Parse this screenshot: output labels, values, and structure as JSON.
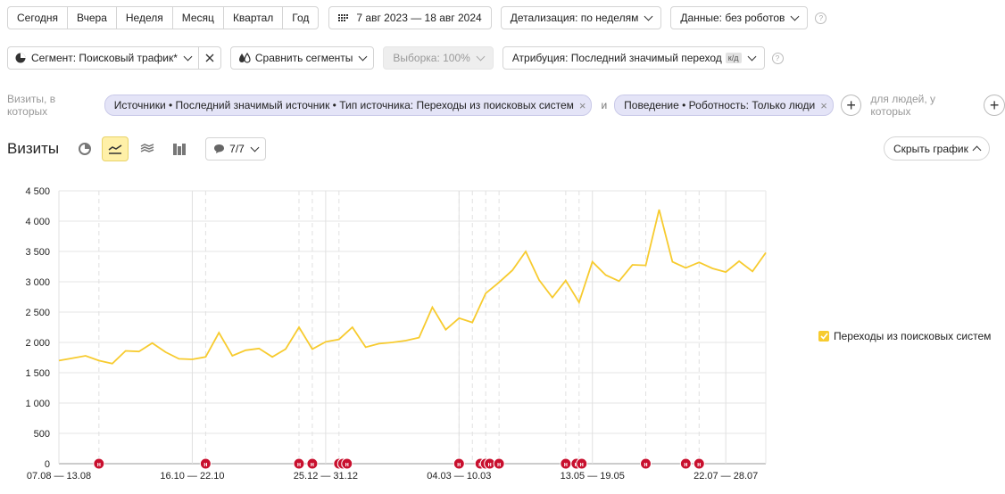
{
  "toolbar": {
    "periods": [
      "Сегодня",
      "Вчера",
      "Неделя",
      "Месяц",
      "Квартал",
      "Год"
    ],
    "date_range": "7 авг 2023 — 18 авг 2024",
    "detail": "Детализация: по неделям",
    "data": "Данные: без роботов"
  },
  "segment_row": {
    "segment": "Сегмент: Поисковый трафик*",
    "compare": "Сравнить сегменты",
    "sample": "Выборка: 100%",
    "attribution": "Атрибуция: Последний значимый переход",
    "attribution_badge": "к/д"
  },
  "filters": {
    "prefix": "Визиты, в которых",
    "chip1": "Источники • Последний значимый источник • Тип источника: Переходы из поисковых систем",
    "and": "и",
    "chip2": "Поведение • Роботность: Только люди",
    "people": "для людей, у которых"
  },
  "chart_header": {
    "title": "Визиты",
    "comments_count": "7/7",
    "hide_chart": "Скрыть график"
  },
  "legend": {
    "label": "Переходы из поисковых систем",
    "color": "#f7cb2f"
  },
  "note_marker": "н",
  "chart_data": {
    "type": "line",
    "ylim": [
      0,
      4500
    ],
    "y_ticks": [
      "0",
      "500",
      "1 000",
      "1 500",
      "2 000",
      "2 500",
      "3 000",
      "3 500",
      "4 000",
      "4 500"
    ],
    "x_tick_labels": [
      "07.08 — 13.08",
      "16.10 — 22.10",
      "25.12 — 31.12",
      "04.03 — 10.03",
      "13.05 — 19.05",
      "22.07 — 28.07"
    ],
    "x_tick_index": [
      0,
      10,
      20,
      30,
      40,
      50
    ],
    "series": [
      {
        "name": "Переходы из поисковых систем",
        "color": "#f7cb2f",
        "values": [
          1700,
          1740,
          1780,
          1700,
          1650,
          1860,
          1850,
          1990,
          1840,
          1730,
          1720,
          1760,
          2160,
          1780,
          1870,
          1900,
          1760,
          1890,
          2250,
          1890,
          2010,
          2050,
          2250,
          1920,
          1980,
          2000,
          2030,
          2080,
          2580,
          2210,
          2400,
          2330,
          2810,
          2990,
          3190,
          3500,
          3030,
          2740,
          3020,
          2660,
          3330,
          3110,
          3010,
          3280,
          3270,
          4190,
          3330,
          3230,
          3320,
          3220,
          3160,
          3340,
          3170,
          3480
        ]
      }
    ],
    "note_positions": [
      3,
      11,
      18,
      19,
      21,
      21.3,
      21.6,
      30,
      31.6,
      32,
      32.3,
      33,
      38,
      38.8,
      39.2,
      44,
      47,
      48
    ]
  }
}
